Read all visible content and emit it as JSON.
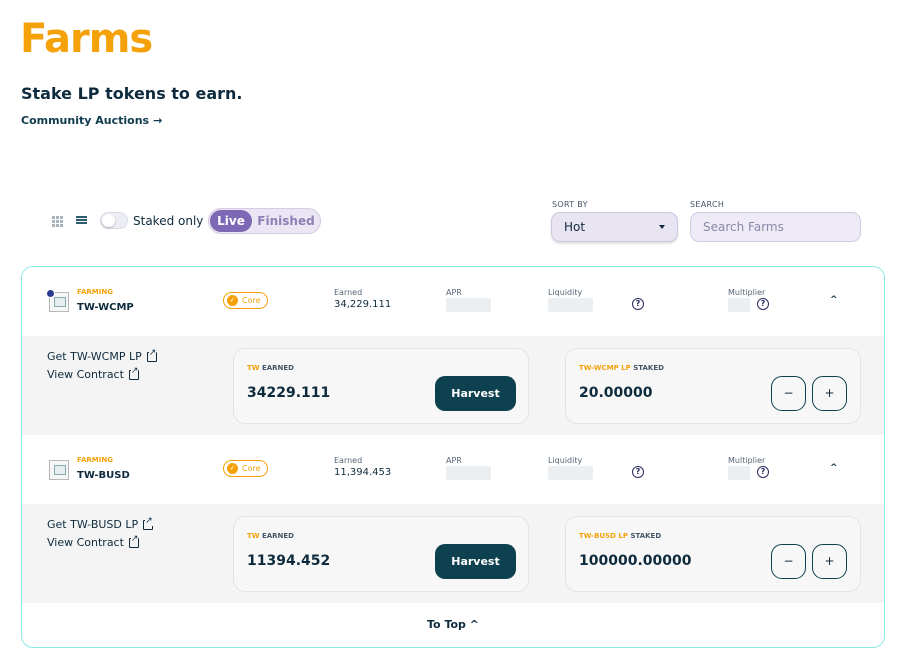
{
  "header": {
    "title": "Farms",
    "subtitle": "Stake LP tokens to earn.",
    "auctions_link": "Community Auctions",
    "auctions_arrow": "→"
  },
  "controls": {
    "staked_only_label": "Staked only",
    "staked_only": false,
    "live_label": "Live",
    "finished_label": "Finished",
    "sort_label": "SORT BY",
    "sort_value": "Hot",
    "search_label": "SEARCH",
    "search_placeholder": "Search Farms"
  },
  "labels": {
    "farming": "FARMING",
    "core": "Core",
    "earned": "Earned",
    "apr": "APR",
    "liquidity": "Liquidity",
    "multiplier": "Multiplier",
    "earned_suffix": "EARNED",
    "staked_suffix": "STAKED",
    "harvest": "Harvest",
    "minus": "−",
    "plus": "+",
    "help": "?",
    "chevron": "^",
    "view_contract": "View Contract"
  },
  "farms": [
    {
      "name": "TW-WCMP",
      "earned": "34,229.111",
      "get_lp": "Get TW-WCMP LP",
      "earned_token": "TW",
      "earned_value": "34229.111",
      "staked_token": "TW-WCMP LP",
      "staked_value": "20.00000"
    },
    {
      "name": "TW-BUSD",
      "earned": "11,394.453",
      "get_lp": "Get TW-BUSD LP",
      "earned_token": "TW",
      "earned_value": "11394.452",
      "staked_token": "TW-BUSD LP",
      "staked_value": "100000.00000"
    }
  ],
  "footer": {
    "to_top": "To Top ^"
  },
  "colors": {
    "accent": "#f5a20a",
    "primary": "#0e4150",
    "toggle_active": "#7c68b5",
    "table_border": "#8ce8e6"
  }
}
